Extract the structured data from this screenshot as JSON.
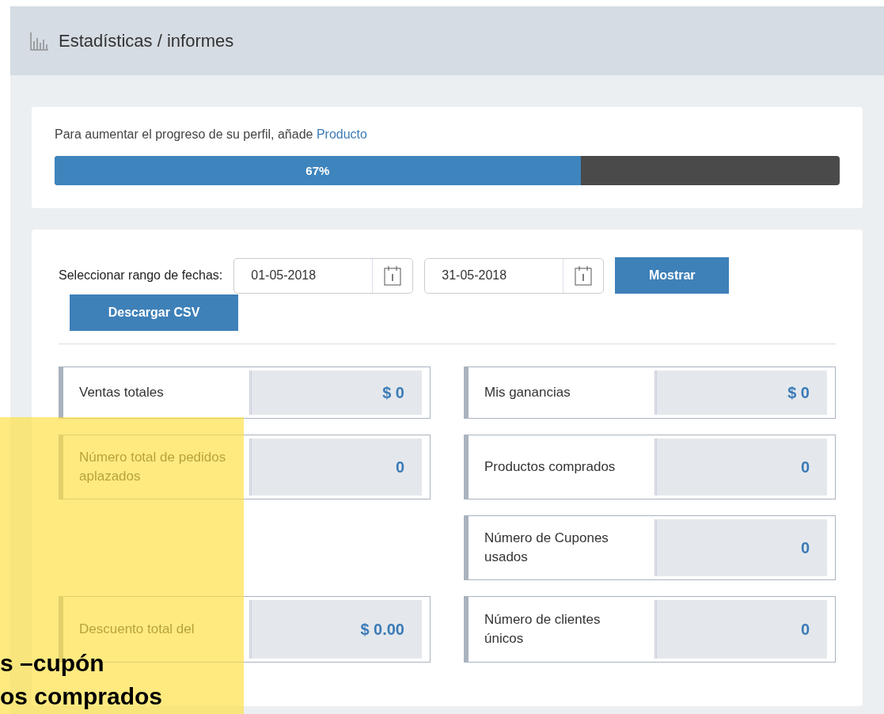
{
  "header": {
    "title": "Estadísticas / informes"
  },
  "profile": {
    "text": "Para aumentar el progreso de su perfil, añade",
    "link": "Producto",
    "level": 0.67,
    "reading": "67%"
  },
  "filters": {
    "label": "Seleccionar rango de fechas:",
    "from": "01-05-2018",
    "to": "31-05-2018",
    "buttons": [
      "Mostrar",
      "Descargar CSV"
    ]
  },
  "stats": [
    {
      "left": {
        "label": "Ventas totales",
        "value": "$ 0"
      },
      "right": {
        "label": "Mis ganancias",
        "value": "$ 0"
      }
    },
    {
      "left": {
        "label": "Número total de pedidos aplazados",
        "value": "0"
      },
      "right": {
        "label": "Productos comprados",
        "value": "0"
      }
    },
    {
      "right": {
        "label": "Número de Cupones usados",
        "value": "0"
      }
    },
    {
      "left": {
        "label": "Descuento total del",
        "value": "$ 0.00"
      },
      "right": {
        "label": "Número de clientes únicos",
        "value": "0"
      }
    }
  ],
  "overlay": {
    "lines": [
      "s –cupón",
      "os comprados"
    ]
  }
}
